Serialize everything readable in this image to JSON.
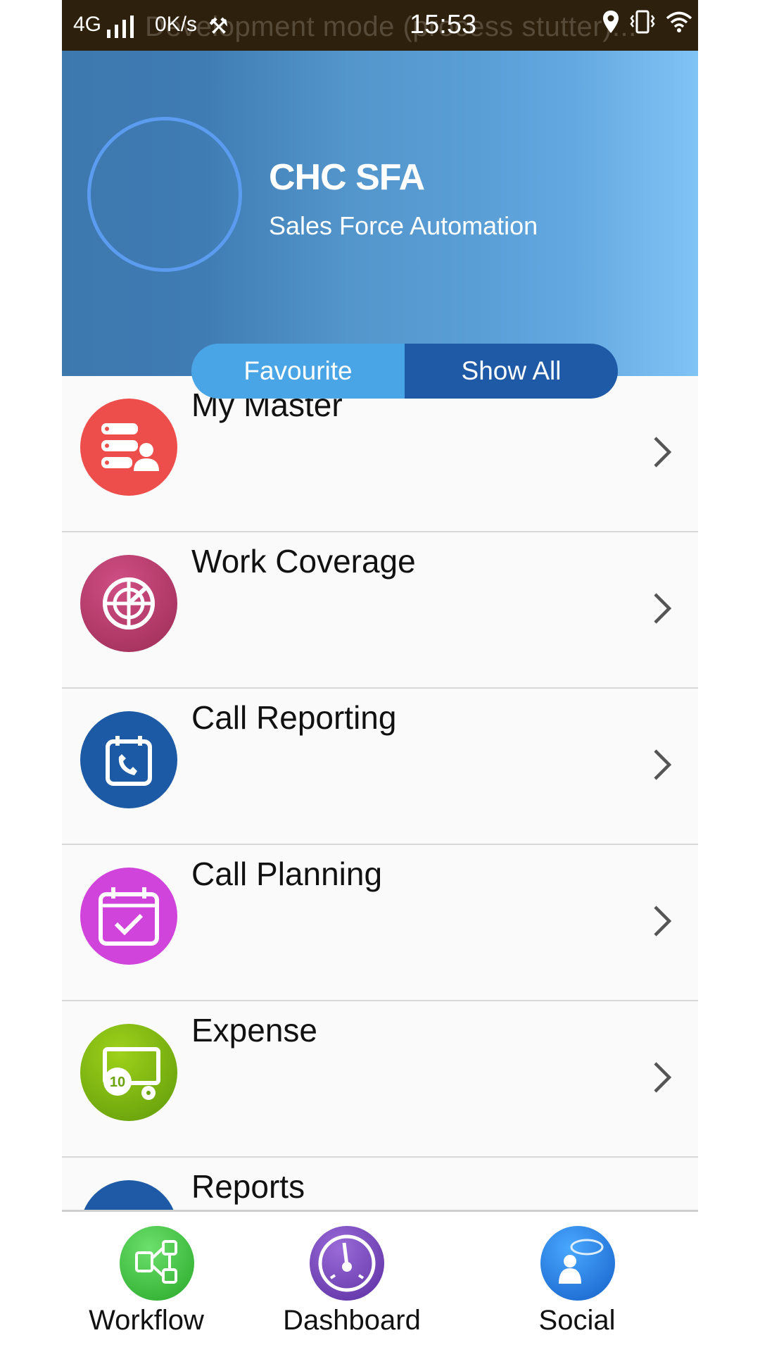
{
  "status_bar": {
    "network": "4G",
    "speed": "0K/s",
    "time": "15:53",
    "overlay_text": "Development mode (process stutter)...",
    "icons": [
      "signal-icon",
      "tools-icon",
      "location-icon",
      "vibrate-icon",
      "wifi-icon"
    ]
  },
  "header": {
    "title": "CHC SFA",
    "subtitle": "Sales Force Automation"
  },
  "toggle": {
    "favourite_label": "Favourite",
    "show_all_label": "Show All",
    "selected": "Show All"
  },
  "menu": {
    "items": [
      {
        "label": "My Master",
        "icon": "server-user-icon",
        "color": "#e8403f"
      },
      {
        "label": "Work Coverage",
        "icon": "globe-radar-icon",
        "color": "#b23461"
      },
      {
        "label": "Call Reporting",
        "icon": "calendar-phone-icon",
        "color": "#1d5aa6"
      },
      {
        "label": "Call Planning",
        "icon": "calendar-check-icon",
        "color": "#cc3fd8"
      },
      {
        "label": "Expense",
        "icon": "money-icon",
        "color": "#7fb20f"
      },
      {
        "label": "Reports",
        "icon": "reports-icon",
        "color": "#1f5aa6"
      }
    ]
  },
  "bottom_nav": {
    "items": [
      {
        "label": "Workflow",
        "icon": "workflow-icon",
        "color": "#3cc43c"
      },
      {
        "label": "Dashboard",
        "icon": "dashboard-gauge-icon",
        "color": "#6a3bb0"
      },
      {
        "label": "Social",
        "icon": "social-chat-icon",
        "color": "#1f7fe0"
      }
    ]
  },
  "colors": {
    "status_bar_bg": "#2d200c",
    "header_gradient_start": "#3d78ad",
    "header_gradient_end": "#80c3f5",
    "toggle_inactive": "#4aa5e6",
    "toggle_active": "#1f5aa6"
  }
}
